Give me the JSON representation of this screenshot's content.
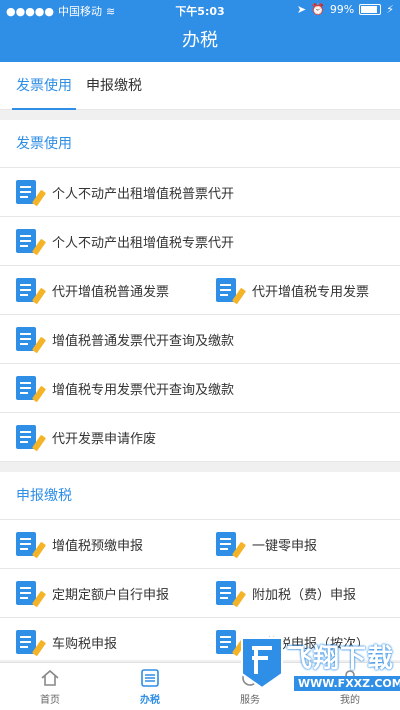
{
  "status_bar": {
    "carrier": "中国移动",
    "time": "下午5:03",
    "battery": "99%"
  },
  "nav": {
    "title": "办税"
  },
  "tabs": [
    {
      "label": "发票使用",
      "active": true
    },
    {
      "label": "申报缴税",
      "active": false
    }
  ],
  "sections": [
    {
      "title": "发票使用",
      "rows": [
        [
          "个人不动产出租增值税普票代开"
        ],
        [
          "个人不动产出租增值税专票代开"
        ],
        [
          "代开增值税普通发票",
          "代开增值税专用发票"
        ],
        [
          "增值税普通发票代开查询及缴款"
        ],
        [
          "增值税专用发票代开查询及缴款"
        ],
        [
          "代开发票申请作废"
        ]
      ]
    },
    {
      "title": "申报缴税",
      "rows": [
        [
          "增值税预缴申报",
          "一键零申报"
        ],
        [
          "定期定额户自行申报",
          "附加税（费）申报"
        ],
        [
          "车购税申报",
          "印花税申报（按次）"
        ]
      ]
    }
  ],
  "tabbar": [
    {
      "label": "首页",
      "icon": "home-icon",
      "active": false
    },
    {
      "label": "办税",
      "icon": "list-icon",
      "active": true
    },
    {
      "label": "服务",
      "icon": "service-icon",
      "active": false
    },
    {
      "label": "我的",
      "icon": "profile-icon",
      "active": false
    }
  ],
  "watermark": {
    "text": "飞翔下载",
    "url": "WWW.FXXZ.COM"
  },
  "colors": {
    "brand": "#2f8ee6",
    "pen": "#f5b428"
  }
}
